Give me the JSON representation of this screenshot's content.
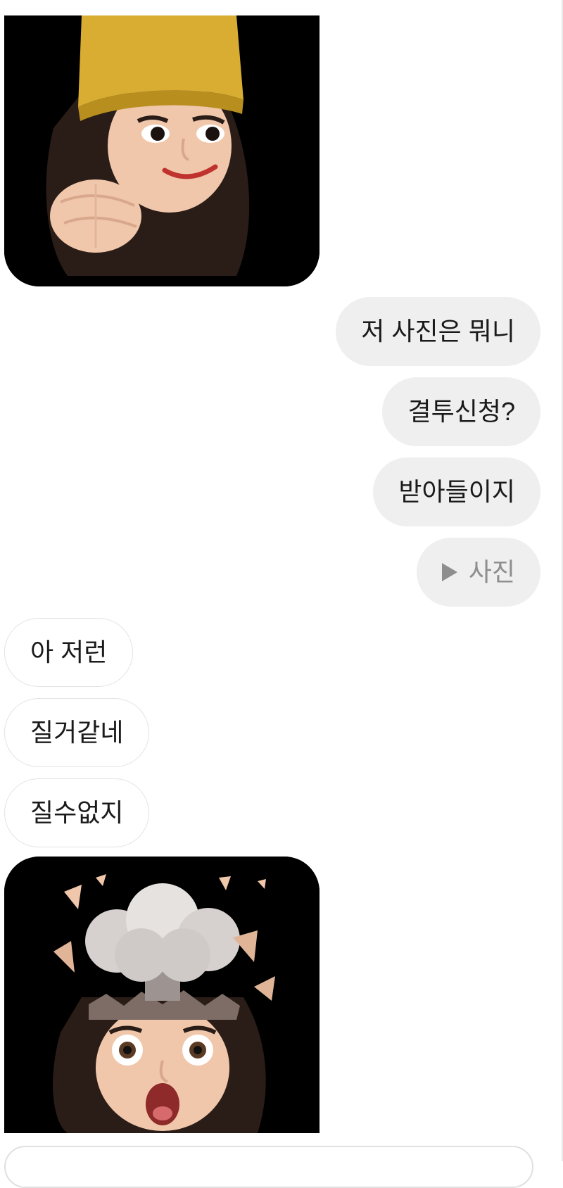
{
  "chat": {
    "messages": [
      {
        "type": "sticker",
        "direction": "received",
        "icon": "memoji-crown-punch-sticker"
      },
      {
        "type": "text",
        "direction": "sent",
        "text": "저 사진은 뭐니"
      },
      {
        "type": "text",
        "direction": "sent",
        "text": "결투신청?"
      },
      {
        "type": "text",
        "direction": "sent",
        "text": "받아들이지"
      },
      {
        "type": "photo",
        "direction": "sent",
        "text": "사진",
        "icon": "play-icon"
      },
      {
        "type": "text",
        "direction": "received",
        "text": "아 저런"
      },
      {
        "type": "text",
        "direction": "received",
        "text": "질거같네"
      },
      {
        "type": "text",
        "direction": "received",
        "text": "질수없지"
      },
      {
        "type": "sticker",
        "direction": "received",
        "icon": "memoji-mind-blown-sticker"
      }
    ]
  },
  "colors": {
    "sent_bubble": "#efefef",
    "received_border": "#e3e3e3",
    "photo_label": "#8e8e8e",
    "sticker_background": "#000000"
  }
}
